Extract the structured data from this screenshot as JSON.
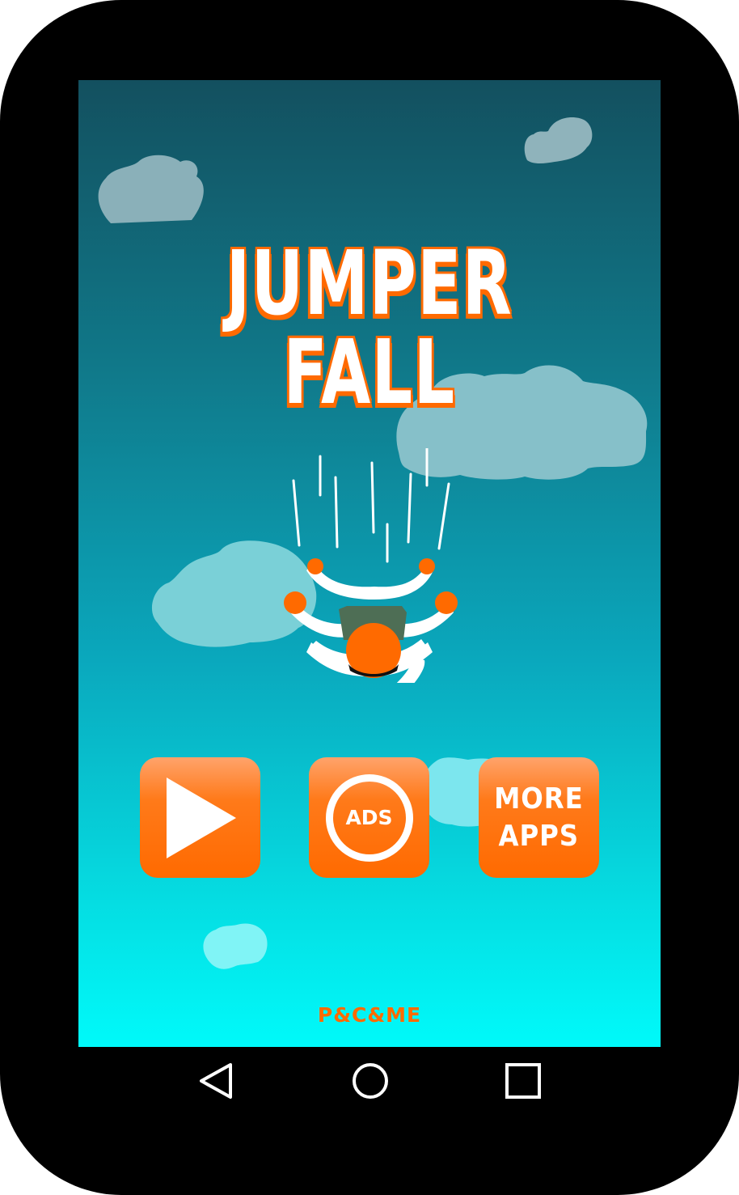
{
  "game": {
    "title": "JUMPER FALL",
    "play_icon": "play-icon",
    "ads_label": "ADS",
    "more_apps": {
      "line1": "MORE",
      "line2": "APPS"
    },
    "footer": "P&C&ME"
  },
  "nav_bar": {
    "back_icon": "back-triangle-icon",
    "home_icon": "home-circle-icon",
    "recents_icon": "recents-square-icon"
  },
  "colors": {
    "accent": "#ff6a00",
    "sky_top": "#13505f",
    "sky_bottom": "#00fafa",
    "device": "#000000"
  }
}
